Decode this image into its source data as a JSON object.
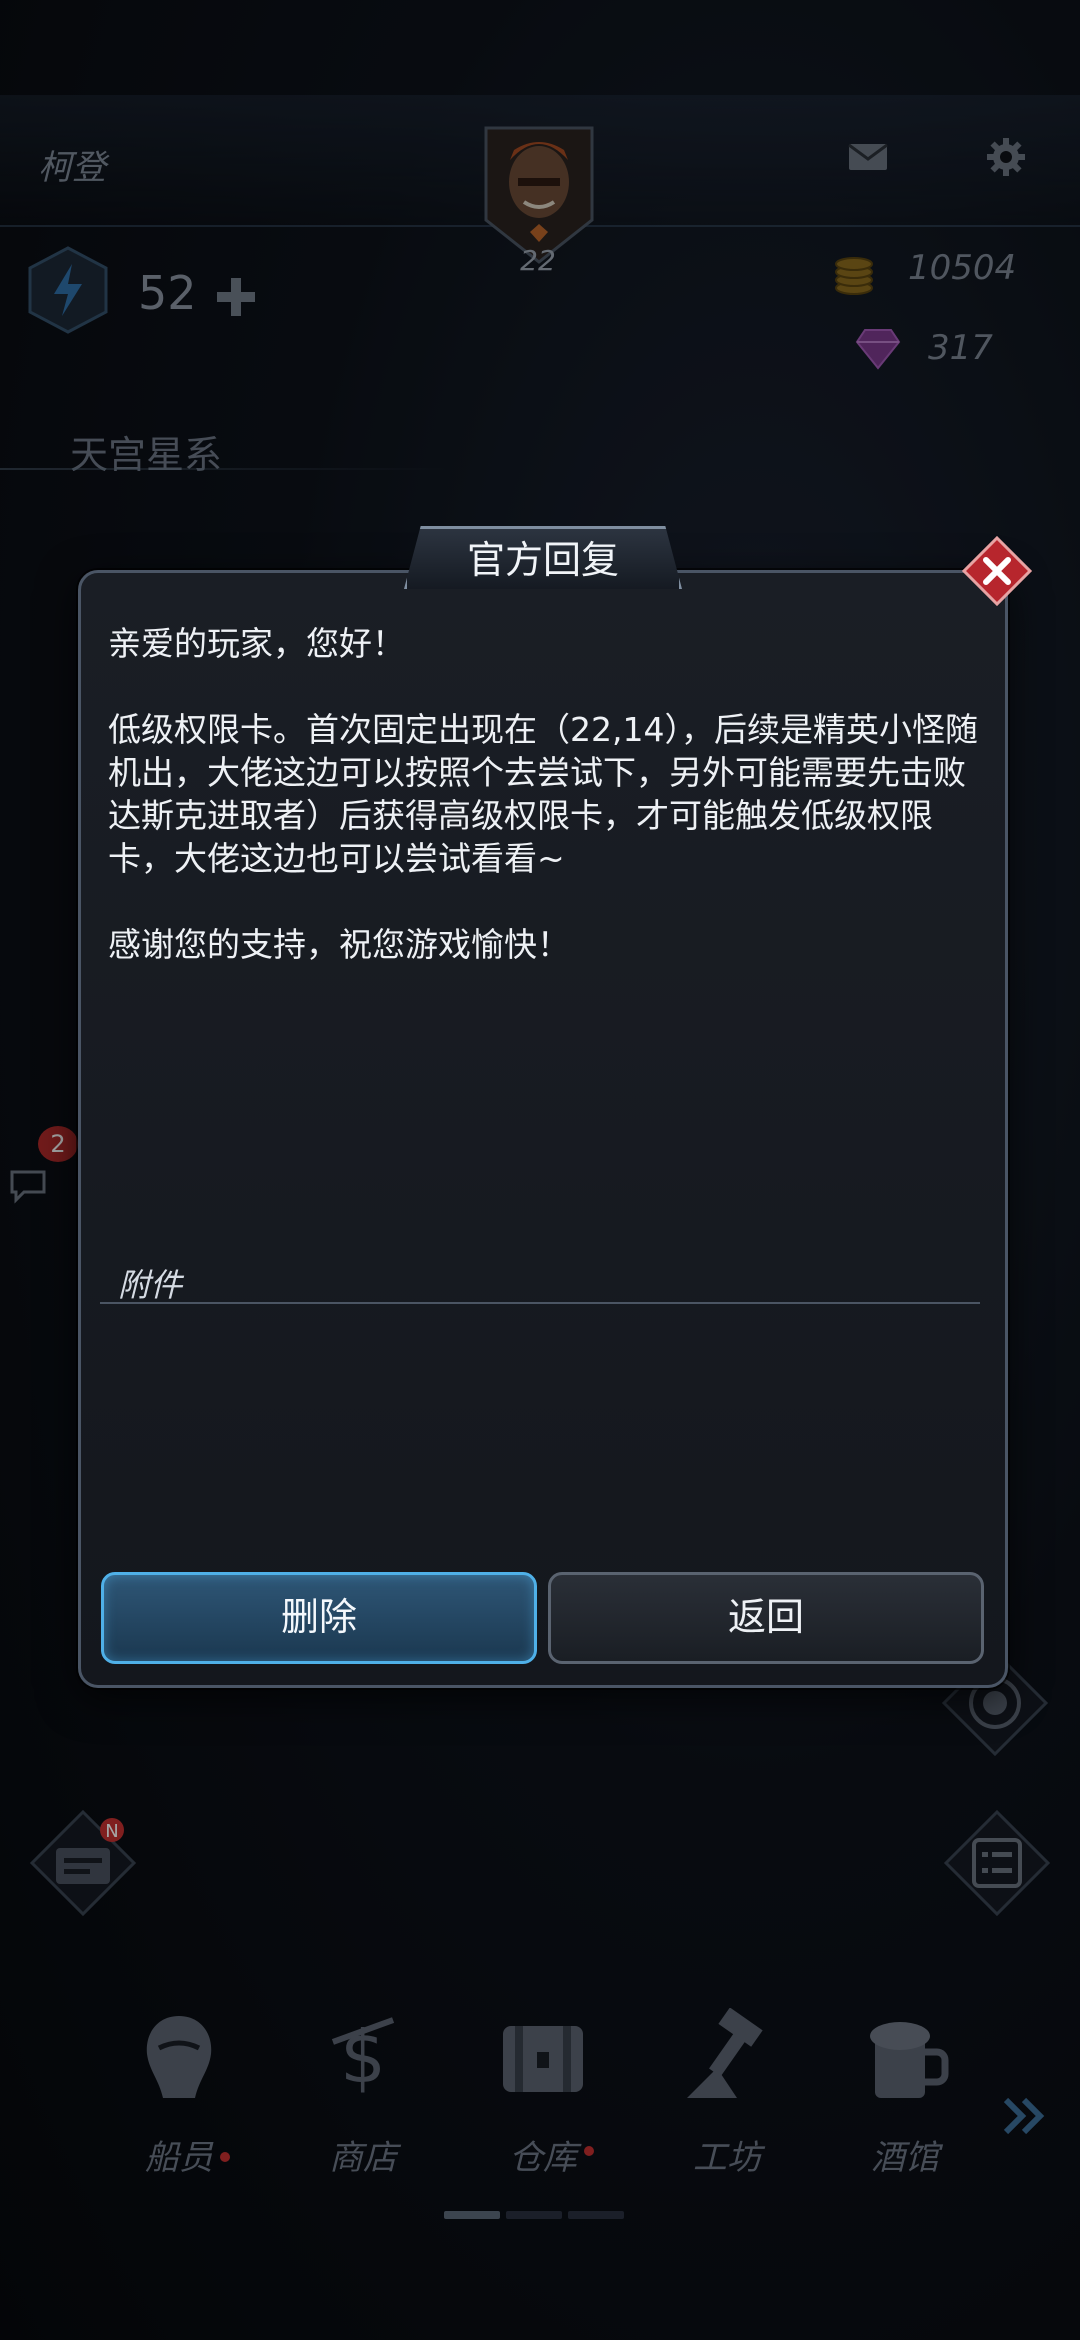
{
  "hud": {
    "player_name": "柯登",
    "level": "22",
    "energy": "52",
    "gold": "10504",
    "gems": "317",
    "region": "天宫星系",
    "chat_badge_count": "2",
    "quest_badge": "N"
  },
  "dialog": {
    "title": "官方回复",
    "message": "亲爱的玩家，您好！\n\n低级权限卡。首次固定出现在（22,14），后续是精英小怪随机出，大佬这边可以按照个去尝试下，另外可能需要先击败达斯克进取者）后获得高级权限卡，才可能触发低级权限卡，大佬这边也可以尝试看看~\n\n感谢您的支持，祝您游戏愉快！",
    "attachment_label": "附件",
    "delete_label": "删除",
    "back_label": "返回"
  },
  "nav": {
    "items": [
      {
        "label": "船员",
        "icon": "crew-icon"
      },
      {
        "label": "商店",
        "icon": "shop-icon"
      },
      {
        "label": "仓库",
        "icon": "warehouse-icon"
      },
      {
        "label": "工坊",
        "icon": "workshop-icon"
      },
      {
        "label": "酒馆",
        "icon": "tavern-icon"
      }
    ]
  },
  "colors": {
    "accent_blue": "#4fb0e8",
    "close_red": "#b7262d",
    "badge_red": "#c53030"
  }
}
